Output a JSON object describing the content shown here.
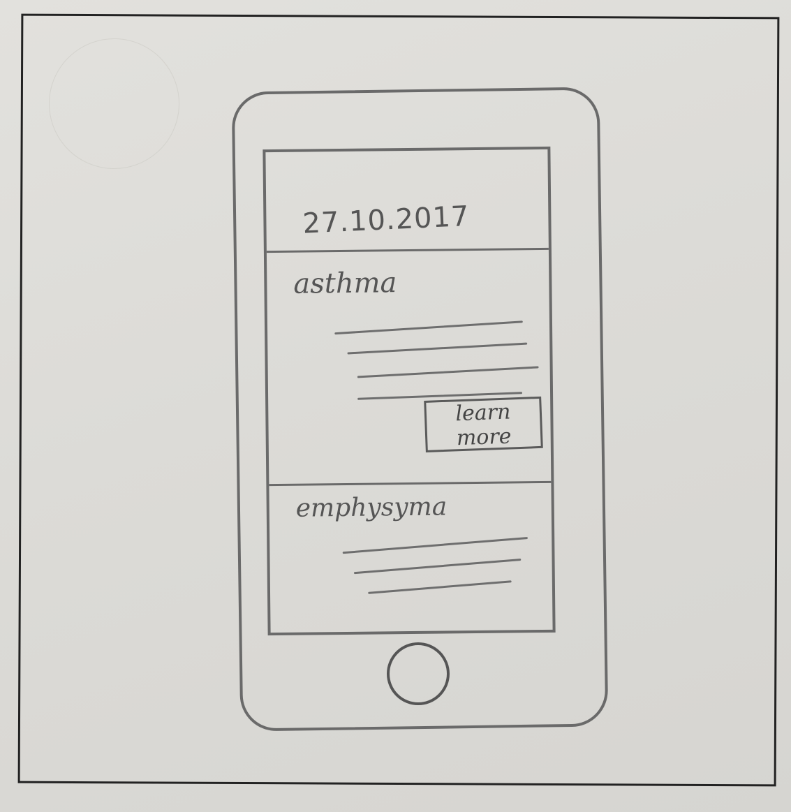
{
  "sketch": {
    "header": {
      "date": "27.10.2017"
    },
    "cards": [
      {
        "title": "asthma",
        "button_label": "learn more"
      },
      {
        "title": "emphysyma"
      }
    ]
  },
  "colors": {
    "pencil": "#6a6a6a",
    "paper": "#dcdbd7",
    "frame": "#222222"
  },
  "icons": {
    "home": "home-button-icon"
  }
}
